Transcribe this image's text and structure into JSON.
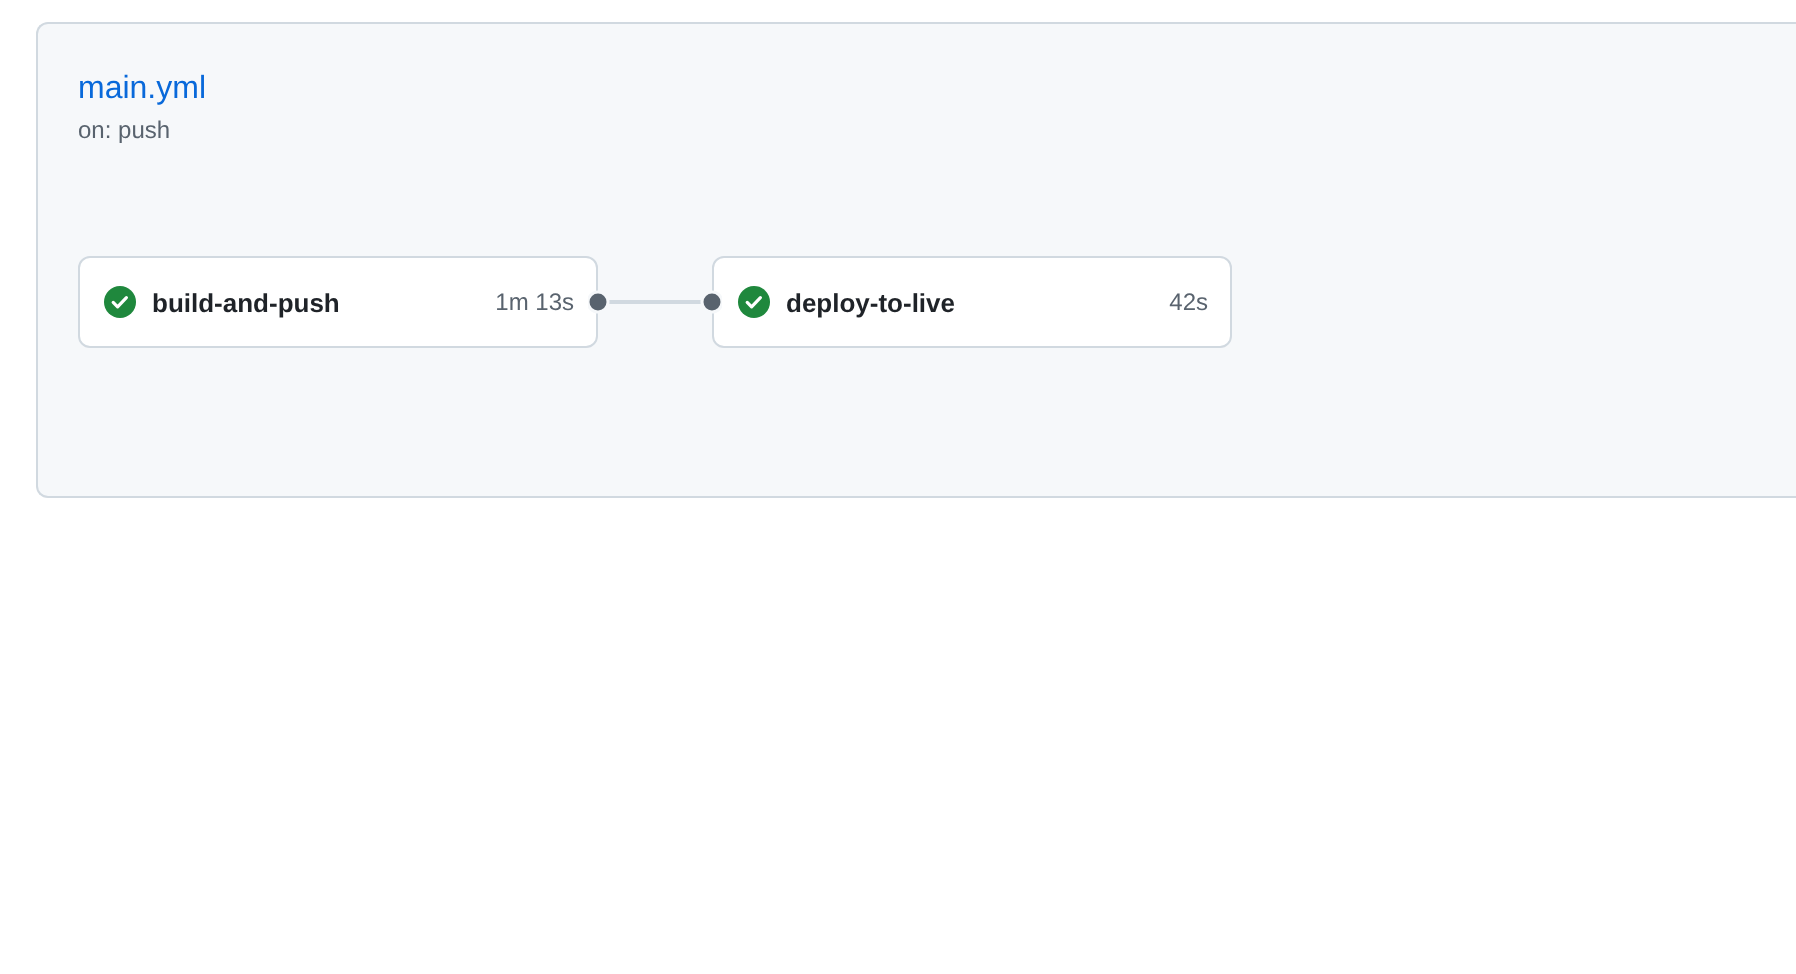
{
  "workflow": {
    "title": "main.yml",
    "trigger": "on: push"
  },
  "jobs": [
    {
      "name": "build-and-push",
      "kind": "success",
      "duration": "1m 13s"
    },
    {
      "name": "deploy-to-live",
      "kind": "success",
      "duration": "42s"
    }
  ]
}
